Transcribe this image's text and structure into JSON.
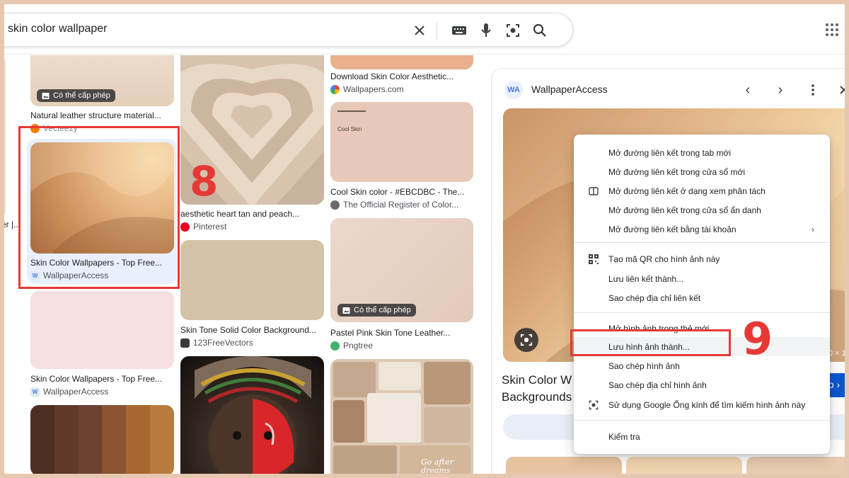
{
  "search": {
    "query": "skin color wallpaper"
  },
  "col1": {
    "top_caption": "Natural leather structure material...",
    "top_badge": "Có thể cấp phép",
    "top_source": "Vecteezy",
    "selected_title": "Skin Color Wallpapers - Top Free...",
    "selected_source": "WallpaperAccess",
    "second_title": "Skin Color Wallpapers - Top Free...",
    "second_source": "WallpaperAccess",
    "edge_text": "er |.."
  },
  "col2": {
    "heart_title": "aesthetic heart tan and peach...",
    "heart_source": "Pinterest",
    "solid_title": "Skin Tone Solid Color Background...",
    "solid_source": "123FreeVectors"
  },
  "col3": {
    "top_title": "Download Skin Color Aesthetic...",
    "top_source": "Wallpapers.com",
    "cool_card_text": "Cool Skin",
    "cool_title": "Cool Skin color - #EBCDBC - The...",
    "cool_source": "The Official Register of Color...",
    "pink_badge": "Có thể cấp phép",
    "pink_title": "Pastel Pink Skin Tone Leather...",
    "pink_source": "Pngtree",
    "collage_text": "Go after dreams"
  },
  "panel": {
    "site": "WallpaperAccess",
    "logo": "WA",
    "title_line1": "Skin Color W",
    "title_line2": "Backgrounds",
    "visit_label": "ập ›",
    "dims_text": "0 × 1"
  },
  "menu": {
    "items": [
      "Mở đường liên kết trong tab mới",
      "Mở đường liên kết trong cửa sổ mới",
      "Mở đường liên kết ở dạng xem phân tách",
      "Mở đường liên kết trong cửa sổ ẩn danh",
      "Mở đường liên kết bằng tài khoản",
      "Tạo mã QR cho hình ảnh này",
      "Lưu liên kết thành...",
      "Sao chép địa chỉ liên kết",
      "Mở hình ảnh trong thẻ mới",
      "Lưu hình ảnh thành...",
      "Sao chép hình ảnh",
      "Sao chép địa chỉ hình ảnh",
      "Sử dụng Google Ống kính để tìm kiếm hình ảnh này",
      "Kiểm tra"
    ]
  },
  "annotations": {
    "step8": "8",
    "step9": "9"
  },
  "colors": {
    "highlight": "#e53935",
    "accent": "#0b57d0"
  }
}
